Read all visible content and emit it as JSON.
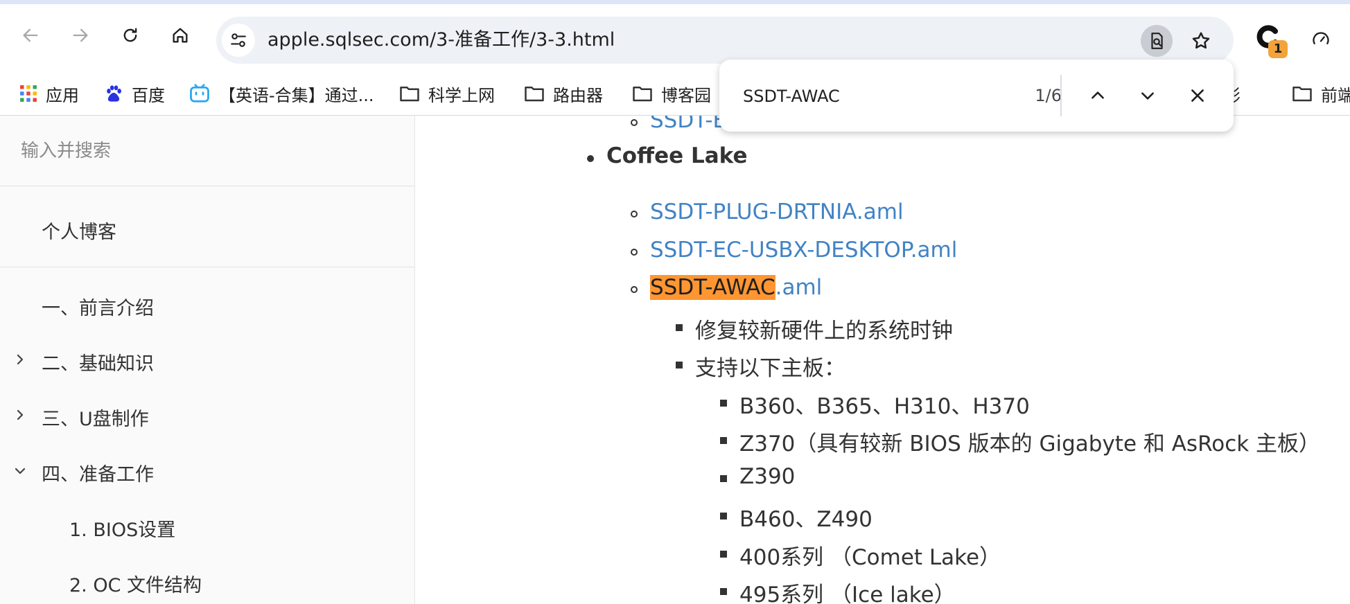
{
  "browser": {
    "url": "apple.sqlsec.com/3-准备工作/3-3.html",
    "extension_badge": "1",
    "colors": {
      "accent": "#4183c4",
      "highlight": "#ff9632",
      "badge": "#f2a33a"
    }
  },
  "bookmarks": [
    {
      "label": "应用",
      "icon": "apps-grid-icon"
    },
    {
      "label": "百度",
      "icon": "baidu-paw-icon"
    },
    {
      "label": "【英语-合集】通过...",
      "icon": "bilibili-tv-icon"
    },
    {
      "label": "科学上网",
      "icon": "folder-icon"
    },
    {
      "label": "路由器",
      "icon": "folder-icon"
    },
    {
      "label": "博客园",
      "icon": "folder-icon"
    },
    {
      "label": "电影",
      "icon": "folder-icon"
    },
    {
      "label": "前端",
      "icon": "folder-icon"
    }
  ],
  "find": {
    "query": "SSDT-AWAC",
    "count": "1/6"
  },
  "sidebar": {
    "search_placeholder": "输入并搜索",
    "blog_link": "个人博客",
    "items": [
      {
        "label": "一、前言介绍",
        "state": "none"
      },
      {
        "label": "二、基础知识",
        "state": "collapsed"
      },
      {
        "label": "三、U盘制作",
        "state": "collapsed"
      },
      {
        "label": "四、准备工作",
        "state": "expanded"
      }
    ],
    "subitems": [
      {
        "label": "1. BIOS设置"
      },
      {
        "label": "2. OC 文件结构"
      }
    ]
  },
  "content": {
    "top_link_partial": "SSDT-E",
    "section_title": "Coffee Lake",
    "links": [
      "SSDT-PLUG-DRTNIA.aml",
      "SSDT-EC-USBX-DESKTOP.aml"
    ],
    "awac_match": "SSDT-AWAC",
    "awac_rest": ".aml",
    "awac_notes": [
      "修复较新硬件上的系统时钟",
      "支持以下主板："
    ],
    "boards": [
      "B360、B365、H310、H370",
      "Z370（具有较新 BIOS 版本的 Gigabyte 和 AsRock 主板）",
      "Z390",
      "B460、Z490",
      "400系列 （Comet Lake）",
      "495系列 （Ice lake）"
    ]
  }
}
